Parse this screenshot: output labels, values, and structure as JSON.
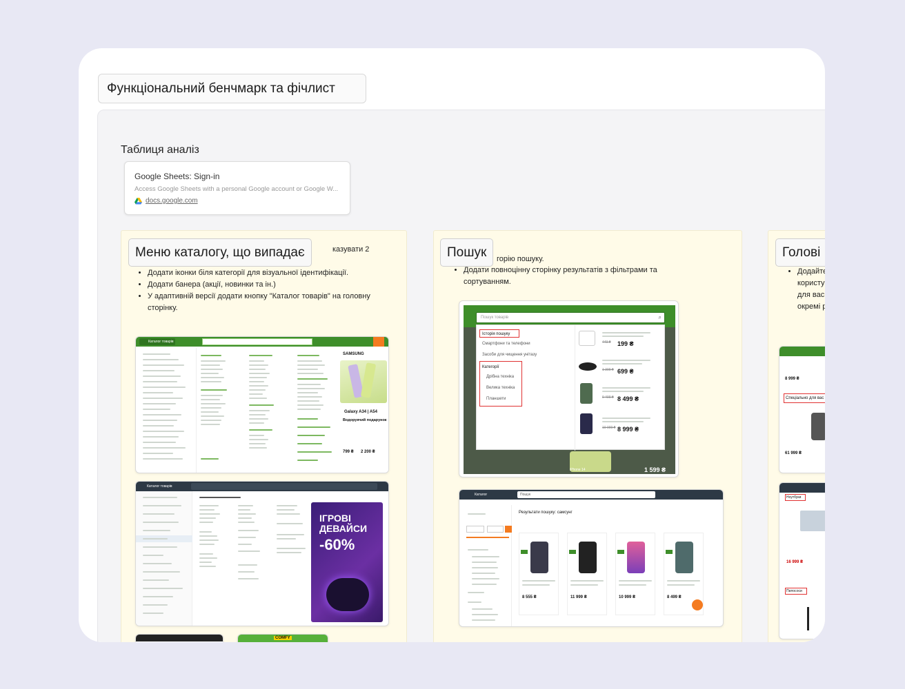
{
  "board": {
    "title": "Функціональний бенчмарк та фічлист",
    "section_label": "Таблиця аналіз"
  },
  "link_card": {
    "title": "Google Sheets: Sign-in",
    "description": "Access Google Sheets with a personal Google account or Google W...",
    "domain": "docs.google.com",
    "icon": "google-drive-icon"
  },
  "frames": [
    {
      "label": "Меню каталогу, що випадає",
      "fragment": "казувати 2",
      "bullets": [
        "Додати іконки біля категорії для візуальної ідентифікації.",
        "Додати банера (акції, новинки та ін.)",
        "У адаптивній версії додати кнопку \"Каталог товарів\" на головну сторінку."
      ],
      "shot1": {
        "header_button": "Каталог товарів",
        "promo_brand": "SAMSUNG",
        "promo_title": "Galaxy A34 | A54",
        "promo_sub": "Водорукчий подарунок",
        "promo_price1": "799 ₴",
        "promo_price2": "2 200 ₴"
      },
      "shot2": {
        "header_button": "Каталог товарів",
        "promo_line1": "ІГРОВІ",
        "promo_line2": "ДЕВАЙСИ",
        "promo_discount": "-60%"
      },
      "shot4_label": "COMFY"
    },
    {
      "label": "Пошук",
      "fragment": "горію пошуку.",
      "bullets": [
        "Додати повноцінну сторінку результатів з фільтрами та сортуванням."
      ],
      "search_shot": {
        "placeholder": "Пошук товарів",
        "history_label": "Історія пошуку",
        "history_items": [
          "Смартфони та телефони",
          "Засоби для чищення унітазу"
        ],
        "categories_label": "Категорії",
        "categories": [
          "Дрібна техніка",
          "Велика техніка",
          "Планшети"
        ],
        "prices": [
          "199 ₴",
          "699 ₴",
          "8 499 ₴",
          "8 999 ₴"
        ],
        "old_prices": [
          "449 ₴",
          "1 399 ₴",
          "9 499 ₴",
          "10 999 ₴"
        ],
        "bottom_label": "iPhone 14",
        "bottom_price": "1 599 ₴"
      },
      "results_shot": {
        "header_button": "Каталог",
        "search_value": "Пошук",
        "results_title": "Результати пошуку: самсунг",
        "prices": [
          "8 555 ₴",
          "11 999 ₴",
          "10 999 ₴",
          "8 499 ₴"
        ]
      }
    },
    {
      "label": "Голові",
      "bullets": [
        "Додайте",
        "користу",
        "для вас",
        "окремі р"
      ],
      "shot1": {
        "price_top": "8 999 ₴",
        "banner": "Спеціально для вас",
        "price_bottom": "61 999 ₴"
      },
      "shot2": {
        "tag_top": "Ноутбуки",
        "price": "16 999 ₴",
        "tag_bottom": "Пилососи"
      }
    }
  ],
  "colors": {
    "accent_green": "#3e8e2a",
    "frame_bg": "#fffbe8",
    "highlight_red": "#e03030",
    "promo_purple": "#4a2390"
  }
}
